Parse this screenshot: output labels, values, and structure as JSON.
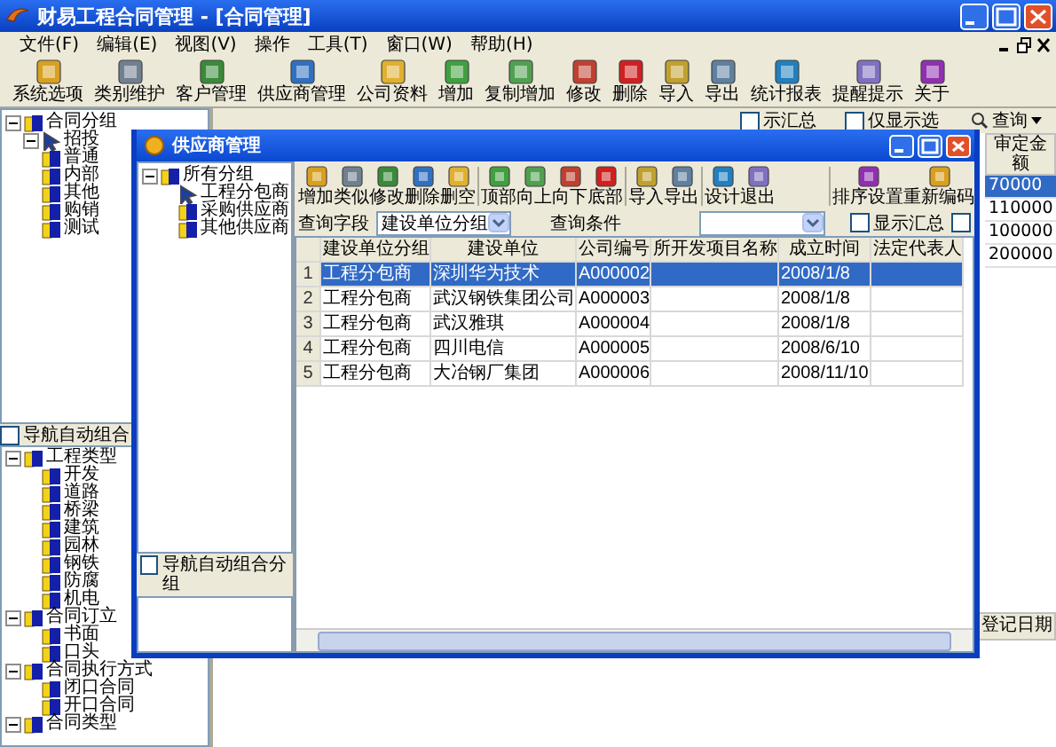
{
  "window": {
    "title": "财易工程合同管理 - [合同管理]"
  },
  "menu": [
    "文件(F)",
    "编辑(E)",
    "视图(V)",
    "操作",
    "工具(T)",
    "窗口(W)",
    "帮助(H)"
  ],
  "toolbar": [
    "系统选项",
    "类别维护",
    "客户管理",
    "供应商管理",
    "公司资料",
    "增加",
    "复制增加",
    "修改",
    "删除",
    "导入",
    "导出",
    "统计报表",
    "提醒提示",
    "关于"
  ],
  "contract_panel": {
    "tree": [
      {
        "label": "合同分组",
        "selected": false,
        "expanded": true,
        "children": [
          {
            "label": "招投",
            "selected": true,
            "expanded": true
          },
          {
            "label": "普通",
            "selected": false
          },
          {
            "label": "内部",
            "selected": false
          },
          {
            "label": "其他",
            "selected": false
          },
          {
            "label": "购销",
            "selected": false
          },
          {
            "label": "测试",
            "selected": false
          }
        ]
      }
    ],
    "auto_group": {
      "label": "导航自动组合",
      "checked": false
    },
    "tree2": [
      {
        "label": "工程类型",
        "selected": false,
        "expanded": true,
        "children": [
          {
            "label": "开发",
            "selected": false
          },
          {
            "label": "道路",
            "selected": false
          },
          {
            "label": "桥梁",
            "selected": false
          },
          {
            "label": "建筑",
            "selected": false
          },
          {
            "label": "园林",
            "selected": false
          },
          {
            "label": "钢铁",
            "selected": false
          },
          {
            "label": "防腐",
            "selected": false
          },
          {
            "label": "机电",
            "selected": false
          }
        ]
      },
      {
        "label": "合同订立",
        "selected": false,
        "expanded": true,
        "children": [
          {
            "label": "书面",
            "selected": false
          },
          {
            "label": "口头",
            "selected": false
          }
        ]
      },
      {
        "label": "合同执行方式",
        "selected": false,
        "expanded": true,
        "children": [
          {
            "label": "闭口合同",
            "selected": false
          },
          {
            "label": "开口合同",
            "selected": false
          }
        ]
      },
      {
        "label": "合同类型",
        "selected": false,
        "expanded": true
      }
    ]
  },
  "contract_view": {
    "filters": [
      {
        "label": "示汇总",
        "checked": false
      },
      {
        "label": "仅显示选",
        "checked": false
      }
    ],
    "query_button": "查询",
    "column": "审定金额",
    "rows": [
      {
        "value": "70000",
        "selected": true
      },
      {
        "value": "110000",
        "selected": false
      },
      {
        "value": "100000",
        "selected": false
      },
      {
        "value": "200000",
        "selected": false
      }
    ],
    "lower_column": "登记日期"
  },
  "dialog": {
    "title": "供应商管理",
    "tree": [
      {
        "label": "所有分组",
        "selected": false,
        "expanded": true,
        "children": [
          {
            "label": "工程分包商",
            "selected": true
          },
          {
            "label": "采购供应商",
            "selected": false
          },
          {
            "label": "其他供应商",
            "selected": false
          }
        ]
      }
    ],
    "auto_group": {
      "label": "导航自动组合分组",
      "checked": false
    },
    "toolbar_groups": [
      [
        "增加",
        "类似",
        "修改",
        "删除",
        "删空"
      ],
      [
        "顶部",
        "向上",
        "向下",
        "底部"
      ],
      [
        "导入",
        "导出"
      ],
      [
        "设计",
        "退出"
      ],
      [
        "排序设置",
        "重新编码"
      ]
    ],
    "query": {
      "field_label": "查询字段",
      "field_value": "建设单位分组",
      "condition_label": "查询条件"
    },
    "summary": {
      "label": "显示汇总",
      "checked": false
    },
    "extra_check": {
      "checked": false
    },
    "table": {
      "columns": [
        "建设单位分组",
        "建设单位",
        "公司编号",
        "所开发项目名称",
        "成立时间",
        "法定代表人"
      ],
      "rows": [
        {
          "number": "1",
          "unit_group": "工程分包商",
          "unit": "深圳华为技术",
          "company_code": "A000002",
          "founded": "2008/1/8",
          "selected": true
        },
        {
          "number": "2",
          "unit_group": "工程分包商",
          "unit": "武汉钢铁集团公司",
          "company_code": "A000003",
          "founded": "2008/1/8",
          "selected": false
        },
        {
          "number": "3",
          "unit_group": "工程分包商",
          "unit": "武汉雅琪",
          "company_code": "A000004",
          "founded": "2008/1/8",
          "selected": false
        },
        {
          "number": "4",
          "unit_group": "工程分包商",
          "unit": "四川电信",
          "company_code": "A000005",
          "founded": "2008/6/10",
          "selected": false
        },
        {
          "number": "5",
          "unit_group": "工程分包商",
          "unit": "大冶钢厂集团",
          "company_code": "A000006",
          "founded": "2008/11/10",
          "selected": false
        }
      ]
    }
  }
}
